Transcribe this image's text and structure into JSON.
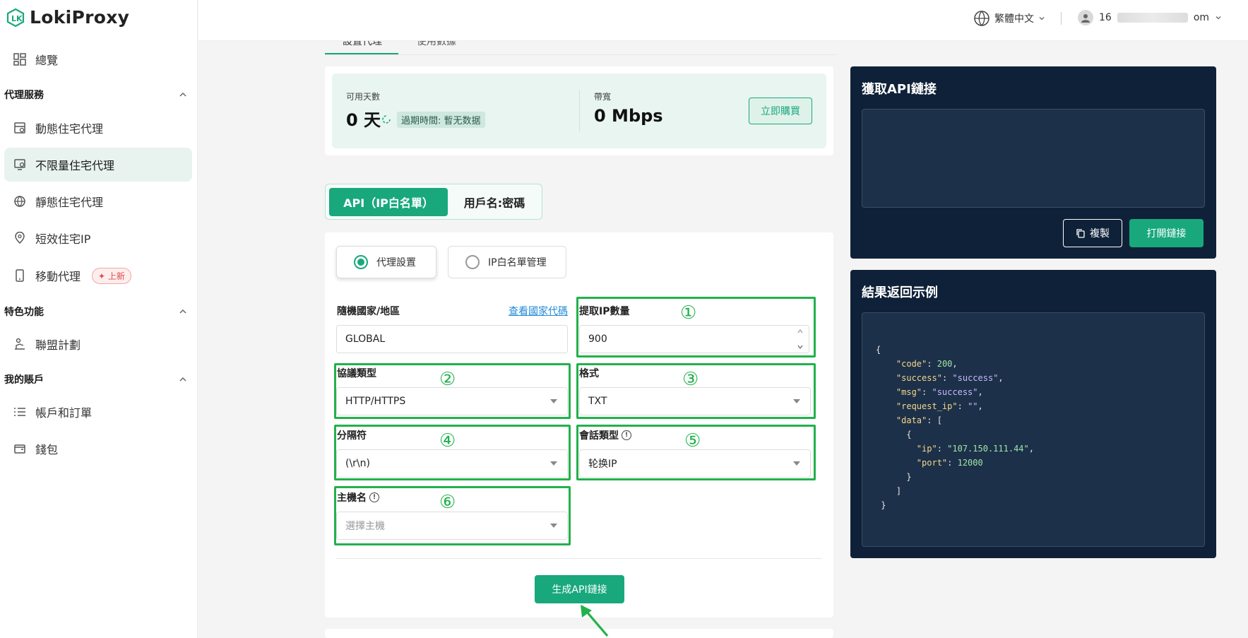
{
  "brand": {
    "name": "LokiProxy"
  },
  "sidebar": {
    "overview": "總覽",
    "groups": [
      {
        "label": "代理服務"
      },
      {
        "label": "特色功能"
      },
      {
        "label": "我的賬戶"
      }
    ],
    "items": [
      {
        "label": "動態住宅代理"
      },
      {
        "label": "不限量住宅代理"
      },
      {
        "label": "靜態住宅代理"
      },
      {
        "label": "短效住宅IP"
      },
      {
        "label": "移動代理",
        "badge": "上新"
      },
      {
        "label": "聯盟計劃"
      },
      {
        "label": "帳戶和訂單"
      },
      {
        "label": "錢包"
      }
    ]
  },
  "header": {
    "language": "繁體中文",
    "user_prefix": "16",
    "user_suffix": "om"
  },
  "top_tabs": [
    "設置代理",
    "使用數據"
  ],
  "stats": {
    "days_label": "可用天數",
    "days_value": "0 天",
    "expire_label": "過期時間: 暫无数据",
    "bandwidth_label": "帶寬",
    "bandwidth_value": "0 Mbps",
    "buy_label": "立即購買"
  },
  "mode_tabs": {
    "active": "API（IP白名單）",
    "inactive": "用戶名:密碼"
  },
  "radios": {
    "proxy_settings": "代理設置",
    "whitelist": "IP白名單管理"
  },
  "form": {
    "country_label": "隨機國家/地區",
    "country_link": "查看國家代碼",
    "country_value": "GLOBAL",
    "count_label": "提取IP數量",
    "count_value": "900",
    "protocol_label": "協議類型",
    "protocol_value": "HTTP/HTTPS",
    "format_label": "格式",
    "format_value": "TXT",
    "separator_label": "分隔符",
    "separator_value": "(\\r\\n)",
    "session_label": "會話類型",
    "session_value": "轮换IP",
    "host_label": "主機名",
    "host_placeholder": "選擇主機",
    "generate_label": "生成API鏈接"
  },
  "markers": [
    "①",
    "②",
    "③",
    "④",
    "⑤",
    "⑥"
  ],
  "api_panel": {
    "title": "獲取API鏈接",
    "copy_label": "複製",
    "open_label": "打開鏈接"
  },
  "result_panel": {
    "title": "結果返回示例"
  },
  "colors": {
    "accent": "#18a87c",
    "dark_panel": "#0f2138",
    "marker": "#22b14c"
  }
}
